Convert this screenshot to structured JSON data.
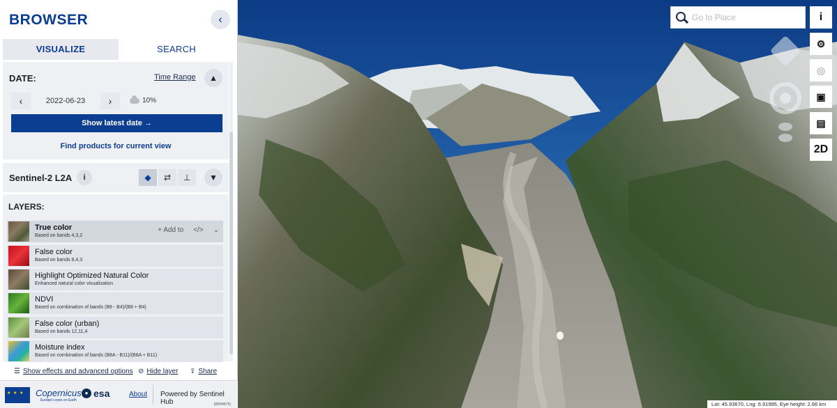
{
  "app": {
    "title": "BROWSER",
    "version": "[895f4675]"
  },
  "tabs": [
    {
      "label": "VISUALIZE",
      "active": true
    },
    {
      "label": "SEARCH",
      "active": false
    }
  ],
  "date": {
    "label": "DATE:",
    "time_range_label": "Time Range",
    "value": "2022-06-23",
    "cloud_cover": "10%",
    "show_latest_label": "Show latest date",
    "find_products_label": "Find products for current view"
  },
  "dataset": {
    "name": "Sentinel-2 L2A"
  },
  "layers": {
    "label": "LAYERS:",
    "add_to_label": "Add to",
    "items": [
      {
        "name": "True color",
        "description": "Based on bands 4,3,2",
        "selected": true
      },
      {
        "name": "False color",
        "description": "Based on bands 8,4,3",
        "selected": false
      },
      {
        "name": "Highlight Optimized Natural Color",
        "description": "Enhanced natural color visualization",
        "selected": false
      },
      {
        "name": "NDVI",
        "description": "Based on combination of bands (B8 - B4)/(B8 + B4)",
        "selected": false
      },
      {
        "name": "False color (urban)",
        "description": "Based on bands 12,11,4",
        "selected": false
      },
      {
        "name": "Moisture index",
        "description": "Based on combination of bands (B8A - B11)/(B8A + B11)",
        "selected": false
      }
    ]
  },
  "bottom_bar": {
    "effects_label": "Show effects and advanced options",
    "hide_layer_label": "Hide layer",
    "share_label": "Share"
  },
  "footer": {
    "copernicus": "opernicus",
    "copernicus_sub": "Europe's eyes on Earth",
    "esa": "esa",
    "about_label": "About",
    "powered_by": "Powered by Sentinel Hub"
  },
  "map": {
    "search_placeholder": "Go to Place",
    "view_mode": "2D",
    "coordinates": "Lat: 45.93670, Lng: 6.91995, Eye height: 2.66 km"
  },
  "colors": {
    "brand": "#0b3d91",
    "panel_bg": "#eef0f3",
    "sky_top": "#0f3f8a"
  }
}
